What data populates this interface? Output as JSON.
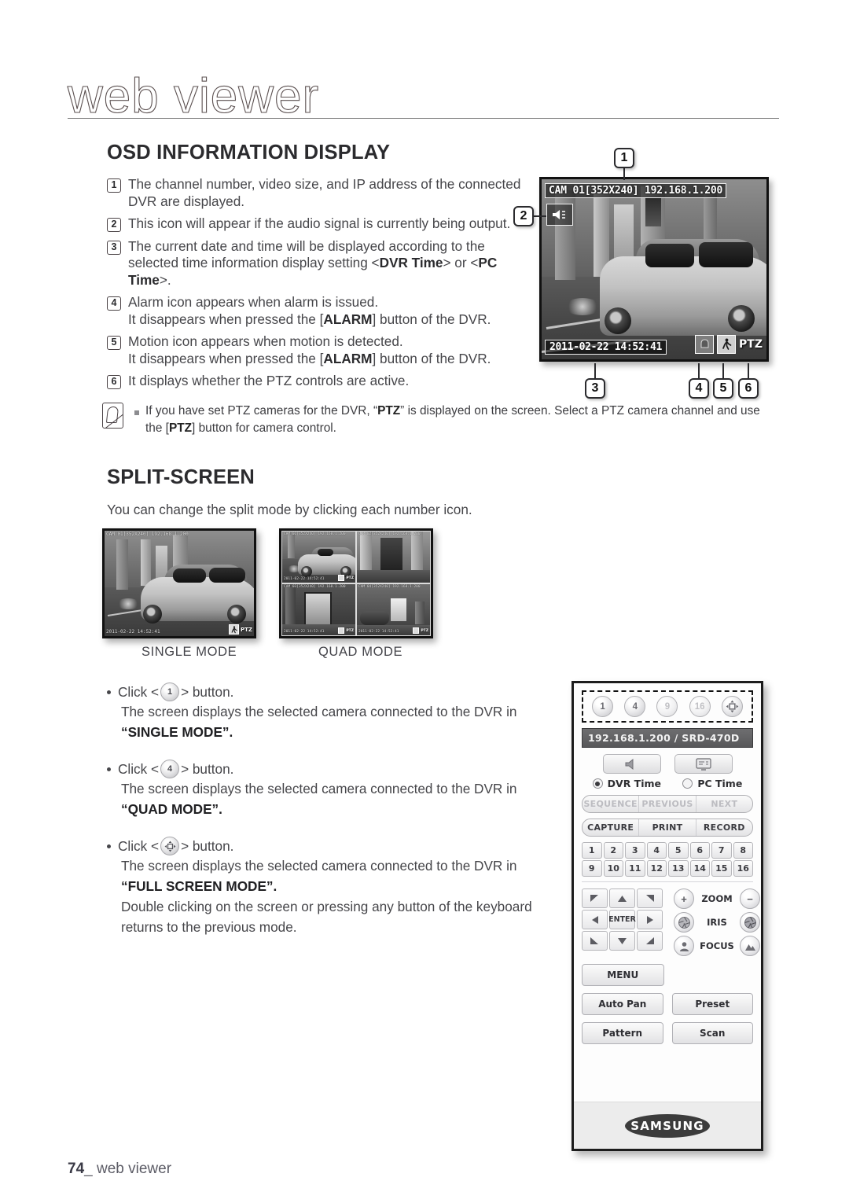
{
  "header": {
    "chapter": "web viewer",
    "rule": true
  },
  "sections": {
    "osd": {
      "heading": "OSD INFORMATION DISPLAY",
      "items": [
        {
          "num": "1",
          "text": "The channel number, video size, and IP address of the connected DVR are displayed."
        },
        {
          "num": "2",
          "text": "This icon will appear if the audio signal is currently being output."
        },
        {
          "num": "3",
          "text": "The current date and time will be displayed according to the selected time information display setting <DVR Time> or <PC Time>."
        },
        {
          "num": "4",
          "text": "Alarm icon appears when alarm is issued. It disappears when pressed the [ALARM] button of the DVR."
        },
        {
          "num": "5",
          "text": "Motion icon appears when motion is detected. It disappears when pressed the [ALARM] button of the DVR."
        },
        {
          "num": "6",
          "text": "It displays whether the PTZ controls are active."
        }
      ],
      "note": "If you have set PTZ cameras for the DVR, “PTZ” is displayed on the screen. Select a PTZ camera channel and use the [PTZ] button for camera control."
    },
    "split": {
      "heading": "SPLIT-SCREEN",
      "description": "You can change the split mode by clicking each number icon.",
      "label_single": "SINGLE MODE",
      "label_quad": "QUAD MODE",
      "bullets": [
        {
          "prefix": "Click <",
          "button": "1",
          "suffix": "> button.",
          "body": "The screen displays the selected camera connected to the DVR in",
          "mode": "“SINGLE MODE”.",
          "extra": ""
        },
        {
          "prefix": "Click <",
          "button": "4",
          "suffix": "> button.",
          "body": "The screen displays the selected camera connected to the DVR in",
          "mode": "“QUAD MODE”.",
          "extra": ""
        },
        {
          "prefix": "Click <",
          "button": "full-screen-icon",
          "suffix": "> button.",
          "body": "The screen displays the selected camera connected to the DVR in",
          "mode": "“FULL SCREEN MODE”.",
          "extra": "Double clicking on the screen or pressing any button of the keyboard returns to the previous mode."
        }
      ]
    }
  },
  "camera_osd": {
    "top_line": "CAM 01[352X240] 192.168.1.200",
    "datetime": "2011-02-22 14:52:41",
    "ptz_label": "PTZ",
    "audio_icon": "speaker-icon",
    "alarm_icon": "alarm-icon",
    "motion_icon": "motion-person-icon",
    "callouts": [
      "1",
      "2",
      "3",
      "4",
      "5",
      "6"
    ]
  },
  "thumbnails": {
    "single": {
      "top_line": "CAM 01[352X240] 192.168.1.200",
      "datetime": "2011-02-22 14:52:41",
      "ptz_label": "PTZ"
    },
    "quad": {
      "cells": [
        {
          "top_line": "CAM 01[352X240] 192.168.1.200",
          "datetime": "2011-02-22 14:52:41",
          "ptz_label": "PTZ"
        },
        {
          "top_line": "CAM 02[352X240] 192.168.1.200",
          "datetime": "",
          "ptz_label": ""
        },
        {
          "top_line": "CAM 03[352X240] 192.168.1.200",
          "datetime": "2011-02-22 14:52:41",
          "ptz_label": "PTZ"
        },
        {
          "top_line": "CAM 04[352X240] 192.168.1.200",
          "datetime": "2011-02-22 14:52:41",
          "ptz_label": "PTZ"
        }
      ]
    }
  },
  "panel": {
    "split_buttons": [
      {
        "label": "1",
        "enabled": true
      },
      {
        "label": "4",
        "enabled": true
      },
      {
        "label": "9",
        "enabled": false
      },
      {
        "label": "16",
        "enabled": false
      },
      {
        "label": "full-screen-icon",
        "enabled": true
      }
    ],
    "ip_bar": "192.168.1.200   / SRD-470D",
    "audio_button": "speaker-icon",
    "display_button": "monitor-icon",
    "time_options": [
      {
        "label": "DVR Time",
        "selected": true
      },
      {
        "label": "PC Time",
        "selected": false
      }
    ],
    "nav_row": [
      {
        "label": "SEQUENCE",
        "enabled": false
      },
      {
        "label": "PREVIOUS",
        "enabled": false
      },
      {
        "label": "NEXT",
        "enabled": false
      }
    ],
    "action_row": [
      {
        "label": "CAPTURE",
        "enabled": true
      },
      {
        "label": "PRINT",
        "enabled": true
      },
      {
        "label": "RECORD",
        "enabled": true
      }
    ],
    "channel_keys_row1": [
      "1",
      "2",
      "3",
      "4",
      "5",
      "6",
      "7",
      "8"
    ],
    "channel_keys_row2": [
      "9",
      "10",
      "11",
      "12",
      "13",
      "14",
      "15",
      "16"
    ],
    "dpad_center": "ENTER",
    "lens_rows": [
      {
        "label": "ZOOM",
        "left_icon": "plus-icon",
        "right_icon": "minus-icon"
      },
      {
        "label": "IRIS",
        "left_icon": "iris-open-icon",
        "right_icon": "iris-close-icon"
      },
      {
        "label": "FOCUS",
        "left_icon": "focus-near-icon",
        "right_icon": "focus-far-icon"
      }
    ],
    "menu_button": "MENU",
    "ptz_buttons": [
      "Auto Pan",
      "Preset",
      "Pattern",
      "Scan"
    ],
    "brand": "SAMSUNG"
  },
  "footer": {
    "page": "74",
    "separator": "_",
    "label": "web viewer"
  },
  "colors": {
    "text": "#46464a",
    "heading": "#2b2b2e",
    "panel_border": "#1c1c1c",
    "ip_bar_bg": "#626264"
  }
}
